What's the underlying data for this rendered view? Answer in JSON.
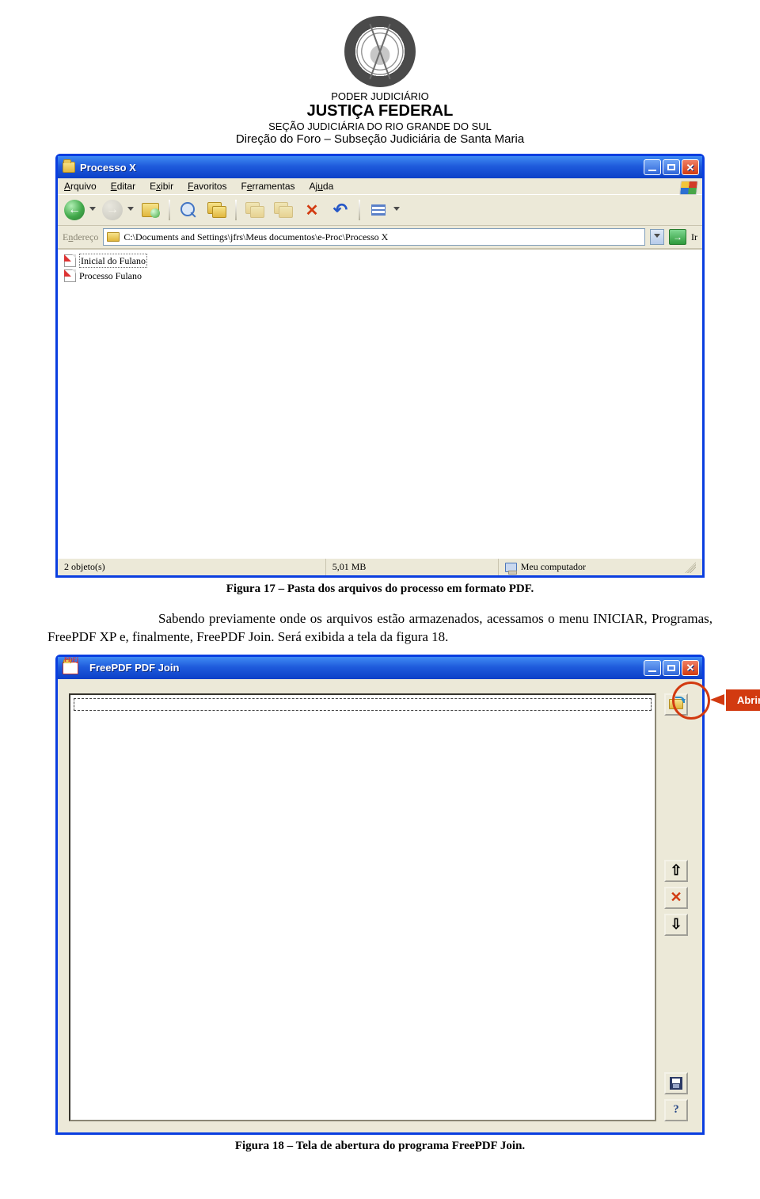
{
  "letterhead": {
    "line1": "PODER JUDICIÁRIO",
    "line2": "JUSTIÇA FEDERAL",
    "line3": "SEÇÃO JUDICIÁRIA DO RIO GRANDE DO SUL",
    "line4": "Direção do Foro – Subseção Judiciária de Santa Maria"
  },
  "explorer": {
    "title": "Processo X",
    "menu": {
      "arquivo": "Arquivo",
      "editar": "Editar",
      "exibir": "Exibir",
      "favoritos": "Favoritos",
      "ferramentas": "Ferramentas",
      "ajuda": "Ajuda"
    },
    "address": {
      "label": "Endereço",
      "path": "C:\\Documents and Settings\\jfrs\\Meus documentos\\e-Proc\\Processo X",
      "go": "Ir"
    },
    "files": [
      {
        "name": "Inicial do Fulano"
      },
      {
        "name": "Processo Fulano"
      }
    ],
    "status": {
      "count": "2 objeto(s)",
      "size": "5,01 MB",
      "location": "Meu computador"
    }
  },
  "caption17": "Figura 17 – Pasta dos arquivos do processo em formato PDF.",
  "paragraph": "Sabendo previamente onde os arquivos estão armazenados, acessamos o menu INICIAR, Programas, FreePDF XP e, finalmente, FreePDF Join.  Será exibida a tela da figura 18.",
  "freepdf": {
    "title": "FreePDF PDF Join",
    "iconlabel": "PDFj"
  },
  "callout": {
    "label": "Abrir"
  },
  "caption18": "Figura 18 – Tela de abertura do programa FreePDF Join."
}
